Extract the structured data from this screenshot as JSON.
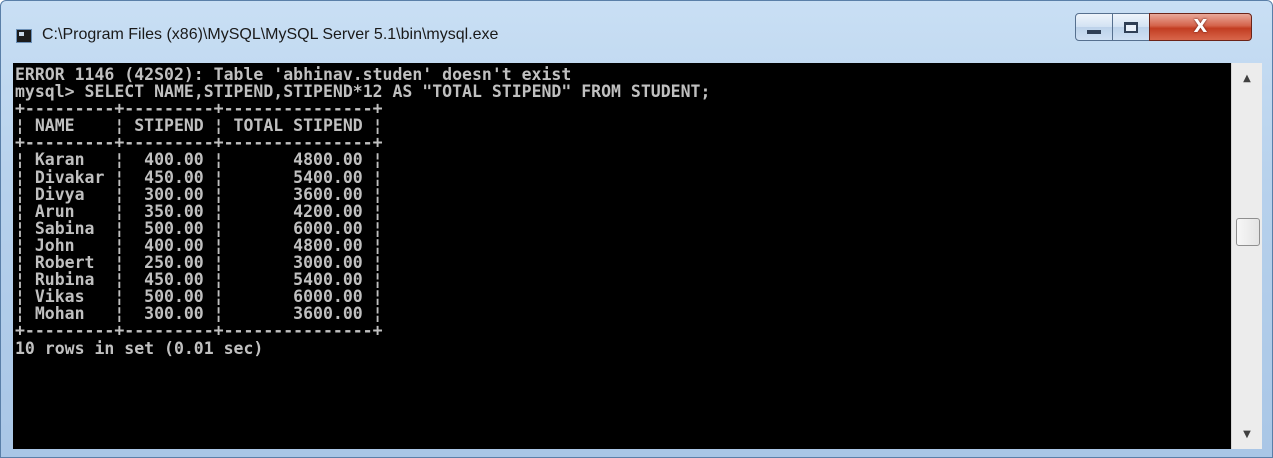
{
  "window": {
    "title": "C:\\Program Files (x86)\\MySQL\\MySQL Server 5.1\\bin\\mysql.exe",
    "icon": "console-app-icon",
    "controls": {
      "minimize_icon": "minimize-icon",
      "maximize_icon": "maximize-icon",
      "close_label": "X"
    }
  },
  "console": {
    "error_line": "ERROR 1146 (42S02): Table 'abhinav.studen' doesn't exist",
    "prompt": "mysql> ",
    "command": "SELECT NAME,STIPEND,STIPEND*12 AS \"TOTAL STIPEND\" FROM STUDENT;",
    "result": {
      "columns": [
        "NAME",
        "STIPEND",
        "TOTAL STIPEND"
      ],
      "rows": [
        [
          "Karan",
          "400.00",
          "4800.00"
        ],
        [
          "Divakar",
          "450.00",
          "5400.00"
        ],
        [
          "Divya",
          "300.00",
          "3600.00"
        ],
        [
          "Arun",
          "350.00",
          "4200.00"
        ],
        [
          "Sabina",
          "500.00",
          "6000.00"
        ],
        [
          "John",
          "400.00",
          "4800.00"
        ],
        [
          "Robert",
          "250.00",
          "3000.00"
        ],
        [
          "Rubina",
          "450.00",
          "5400.00"
        ],
        [
          "Vikas",
          "500.00",
          "6000.00"
        ],
        [
          "Mohan",
          "300.00",
          "3600.00"
        ]
      ],
      "summary": "10 rows in set (0.01 sec)"
    }
  },
  "scrollbar": {
    "up_icon": "scroll-up-arrow-icon",
    "down_icon": "scroll-down-arrow-icon"
  },
  "colors": {
    "console_background": "#000000",
    "console_text": "#c0c0c0",
    "close_button": "#c23d22"
  }
}
